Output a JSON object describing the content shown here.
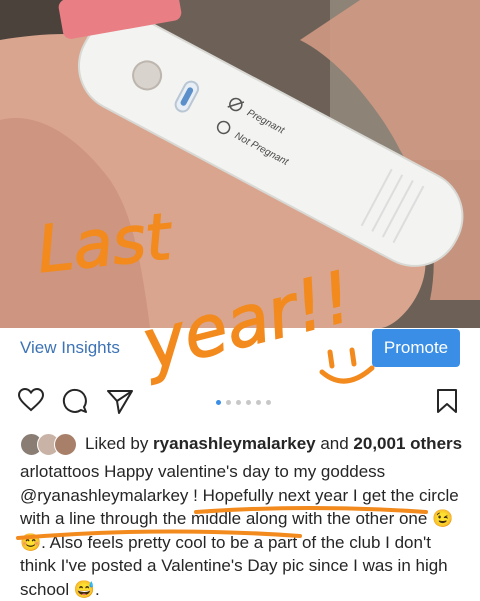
{
  "photo": {
    "test_labels": [
      "Pregnant",
      "Not Pregnant"
    ],
    "handwriting": [
      "Last",
      "year!!"
    ]
  },
  "actions": {
    "view_insights": "View Insights",
    "promote": "Promote"
  },
  "icons": {
    "like": "heart-icon",
    "comment": "comment-icon",
    "share": "send-icon",
    "save": "bookmark-icon"
  },
  "carousel": {
    "total": 6,
    "current": 1
  },
  "likes": {
    "prefix": "Liked by ",
    "user": "ryanashleymalarkey",
    "middle": " and ",
    "count": "20,001 others"
  },
  "caption": {
    "username": "arlotattoos",
    "text1": " Happy valentine's day to my goddess",
    "mention": "@ryanashleymalarkey",
    "text2": " ! Hopefully next year I get the circle with a line through the middle along with the other one 😉😊. Also feels pretty cool to be a part of the club I don't think I've posted a Valentine's Day pic since I was in high school 😅."
  },
  "colors": {
    "accent": "#3a8ee6",
    "link": "#3d73b5",
    "handwriting": "#f28a1e"
  }
}
